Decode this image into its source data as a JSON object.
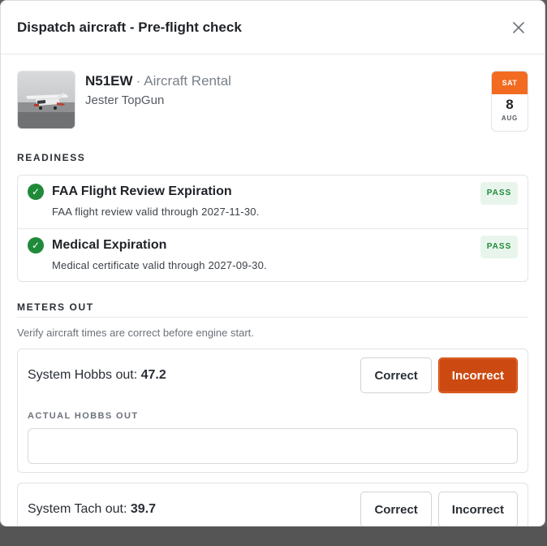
{
  "modal": {
    "title": "Dispatch aircraft - Pre-flight check",
    "close_icon": "close-icon"
  },
  "aircraft": {
    "tail_number": "N51EW",
    "separator": "·",
    "category": "Aircraft Rental",
    "pilot_name": "Jester TopGun",
    "thumbnail": "aircraft-photo"
  },
  "date_badge": {
    "day_of_week": "SAT",
    "day": "8",
    "month": "AUG",
    "accent_color": "#f26b21"
  },
  "readiness": {
    "label": "READINESS",
    "items": [
      {
        "title": "FAA Flight Review Expiration",
        "detail": "FAA flight review valid through 2027-11-30.",
        "status": "PASS",
        "icon": "check-circle-icon"
      },
      {
        "title": "Medical Expiration",
        "detail": "Medical certificate valid through 2027-09-30.",
        "status": "PASS",
        "icon": "check-circle-icon"
      }
    ]
  },
  "meters_out": {
    "label": "METERS OUT",
    "description": "Verify aircraft times are correct before engine start.",
    "hobbs": {
      "label": "System Hobbs out:",
      "value": "47.2",
      "correct_label": "Correct",
      "incorrect_label": "Incorrect",
      "selected": "Incorrect",
      "actual_label": "ACTUAL HOBBS OUT",
      "actual_value": "",
      "actual_placeholder": ""
    },
    "tach": {
      "label": "System Tach out:",
      "value": "39.7",
      "correct_label": "Correct",
      "incorrect_label": "Incorrect"
    }
  },
  "colors": {
    "accent": "#cc4a12",
    "pass_green": "#1f8a3a",
    "pass_bg": "#e8f5ec"
  }
}
